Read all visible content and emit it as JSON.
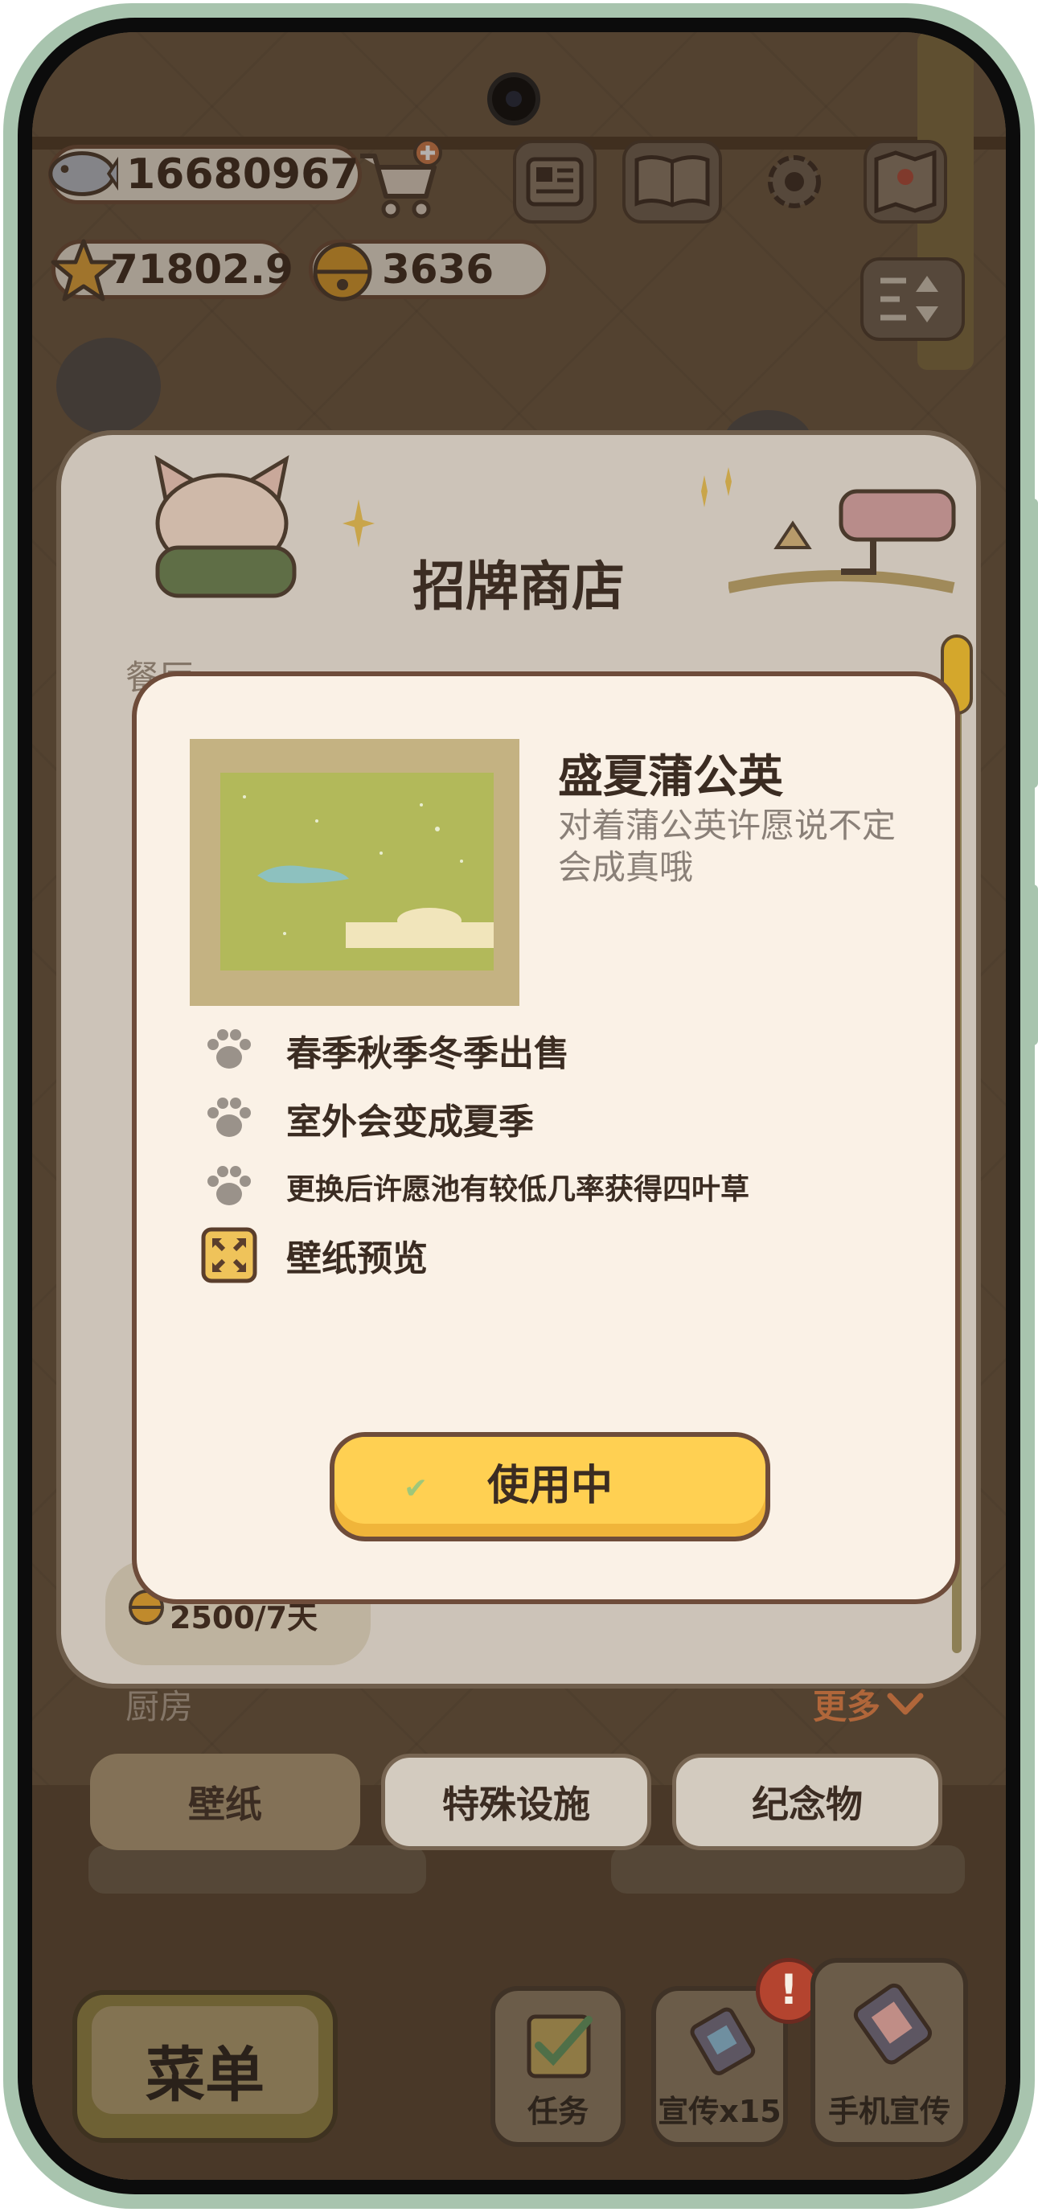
{
  "hud": {
    "fish": "16680967",
    "stars": "71802.9",
    "bells": "3636"
  },
  "shop": {
    "title": "招牌商店",
    "section_top_partial": "餐厅",
    "section_kitchen": "厨房",
    "more_label": "更多",
    "price_label": "2500/7天",
    "tabs": [
      "壁纸",
      "特殊设施",
      "纪念物"
    ]
  },
  "dialog": {
    "item_title": "盛夏蒲公英",
    "item_desc": "对着蒲公英许愿说不定会成真哦",
    "features": [
      "春季秋季冬季出售",
      "室外会变成夏季",
      "更换后许愿池有较低几率获得四叶草",
      "壁纸预览"
    ],
    "use_button": "使用中"
  },
  "bottom": {
    "menu": "菜单",
    "task": "任务",
    "promote": "宣传x15",
    "phone_promote": "手机宣传",
    "badge": "!"
  },
  "colors": {
    "dialog_bg": "#faf1e6",
    "accent_yellow": "#ffd052",
    "border_brown": "#6e4c3a",
    "more_orange": "#b0663a"
  }
}
